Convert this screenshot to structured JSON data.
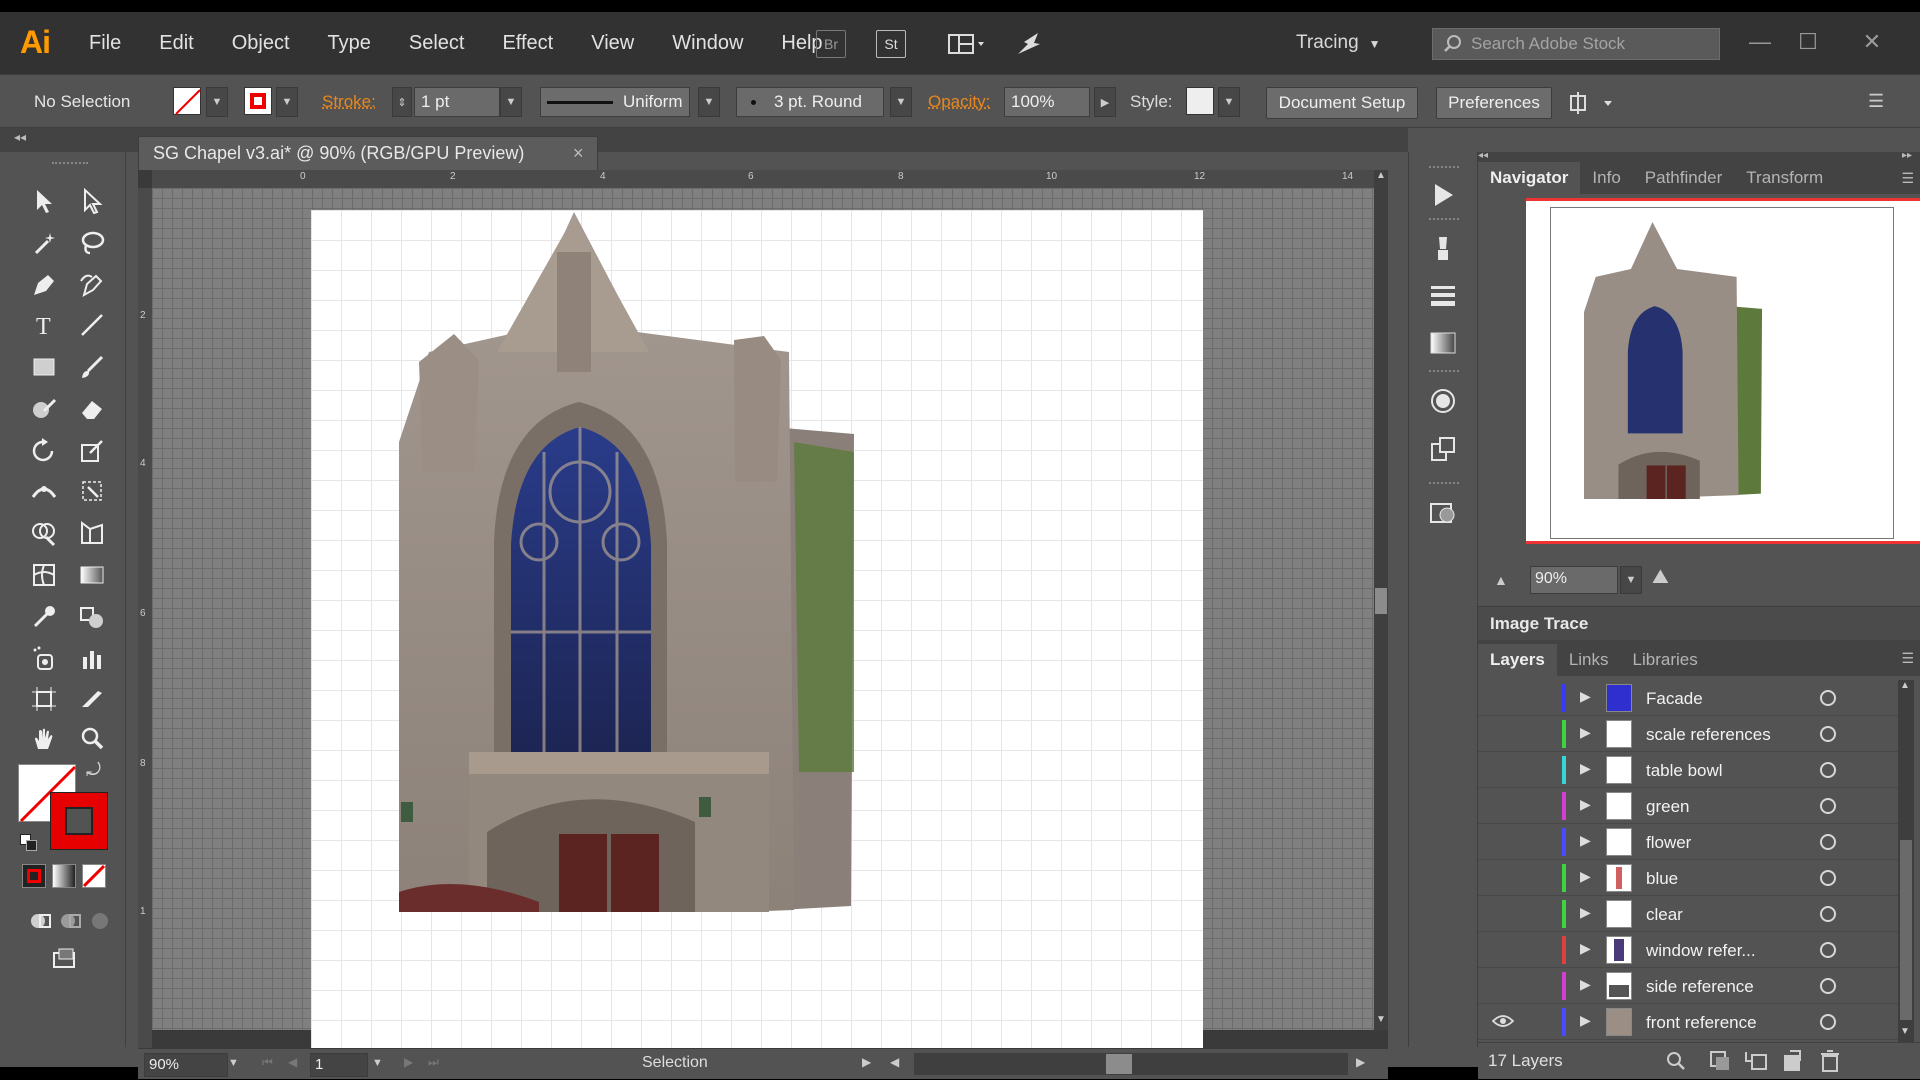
{
  "app": {
    "logo": "Ai",
    "menu": [
      "File",
      "Edit",
      "Object",
      "Type",
      "Select",
      "Effect",
      "View",
      "Window",
      "Help"
    ],
    "bridge_label": "Br",
    "stock_label": "St",
    "workspace": "Tracing",
    "stock_search_placeholder": "Search Adobe Stock"
  },
  "control_bar": {
    "selection": "No Selection",
    "stroke_label": "Stroke:",
    "stroke_weight": "1 pt",
    "profile": "Uniform",
    "brush": "3 pt. Round",
    "opacity_label": "Opacity:",
    "opacity_value": "100%",
    "style_label": "Style:",
    "document_setup": "Document Setup",
    "preferences": "Preferences"
  },
  "document": {
    "tab_title": "SG Chapel v3.ai* @ 90% (RGB/GPU Preview)",
    "close": "×",
    "ruler_h_ticks": [
      "0",
      "2",
      "4",
      "6",
      "8",
      "10",
      "12",
      "14"
    ],
    "ruler_v_ticks": [
      "2",
      "4",
      "6",
      "8",
      "1"
    ]
  },
  "status_bar": {
    "zoom": "90%",
    "artboard": "1",
    "tool": "Selection"
  },
  "navigator": {
    "tabs": [
      "Navigator",
      "Info",
      "Pathfinder",
      "Transform"
    ],
    "zoom": "90%"
  },
  "image_trace": {
    "title": "Image Trace"
  },
  "layers_panel": {
    "tabs": [
      "Layers",
      "Links",
      "Libraries"
    ],
    "layers": [
      {
        "name": "Facade",
        "color": "#3a3aff",
        "visible": false
      },
      {
        "name": "scale references",
        "color": "#3fd43f",
        "visible": false
      },
      {
        "name": "table bowl",
        "color": "#37d6d6",
        "visible": false
      },
      {
        "name": "green",
        "color": "#d23fd2",
        "visible": false
      },
      {
        "name": "flower",
        "color": "#4a4aff",
        "visible": false
      },
      {
        "name": "blue",
        "color": "#3fd43f",
        "visible": false
      },
      {
        "name": "clear",
        "color": "#3fd43f",
        "visible": false
      },
      {
        "name": "window refer...",
        "color": "#e04040",
        "visible": false
      },
      {
        "name": "side reference",
        "color": "#d23fd2",
        "visible": false
      },
      {
        "name": "front reference",
        "color": "#4a4aff",
        "visible": true
      }
    ],
    "count": "17 Layers"
  },
  "colors": {
    "accent_orange": "#ff9a00",
    "stroke_red": "#ff0000"
  }
}
